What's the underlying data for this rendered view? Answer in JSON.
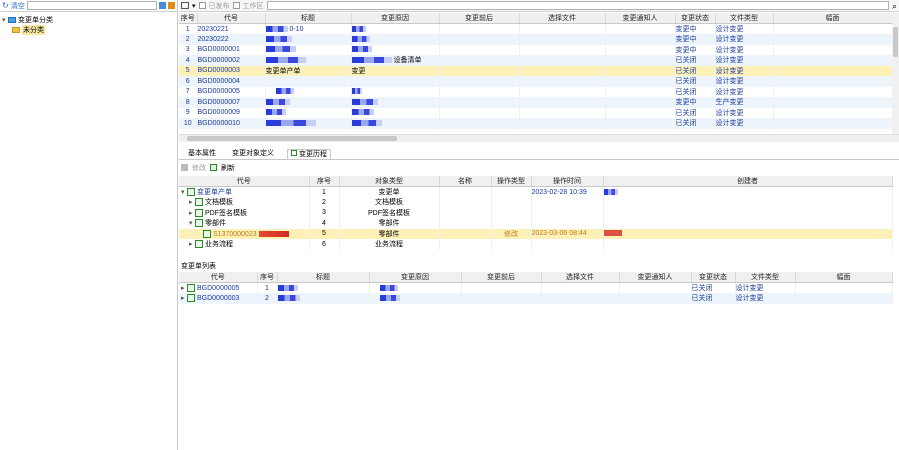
{
  "left": {
    "search_label": "清空",
    "tree": [
      {
        "label": "变更单分类",
        "level": 0
      },
      {
        "label": "未分类",
        "level": 1
      }
    ]
  },
  "toolbar": {
    "option1": "已发布",
    "option2": "工作区"
  },
  "main_table": {
    "columns": [
      "序号",
      "代号",
      "标题",
      "变更原因",
      "变更前后",
      "选择文件",
      "变更通知人",
      "变更状态",
      "文件类型",
      "幅面"
    ],
    "rows": [
      {
        "idx": "1",
        "code": "20230221",
        "title_tail": "0-10",
        "status": "变更中",
        "type": "设计变更"
      },
      {
        "idx": "2",
        "code": "20230222",
        "title_tail": "",
        "status": "变更中",
        "type": "设计变更"
      },
      {
        "idx": "3",
        "code": "BGD0000001",
        "title_tail": "",
        "status": "变更中",
        "type": "设计变更"
      },
      {
        "idx": "4",
        "code": "BGD0000002",
        "title_tail": "",
        "reason_tail": "设备清单",
        "status": "已关闭",
        "type": "设计变更"
      },
      {
        "idx": "5",
        "code": "BGD0000003",
        "title_text": "变更单产单",
        "reason_text": "变更",
        "status": "已关闭",
        "type": "设计变更"
      },
      {
        "idx": "6",
        "code": "BGD0000004",
        "title_tail": "",
        "status": "已关闭",
        "type": "设计变更"
      },
      {
        "idx": "7",
        "code": "BGD0000005",
        "title_tail": "",
        "status": "已关闭",
        "type": "设计变更"
      },
      {
        "idx": "8",
        "code": "BGD0000007",
        "title_tail": "",
        "status": "变更中",
        "type": "生产变更"
      },
      {
        "idx": "9",
        "code": "BGD0000009",
        "title_tail": "",
        "status": "已关闭",
        "type": "设计变更"
      },
      {
        "idx": "10",
        "code": "BGD0000010",
        "title_tail": "",
        "status": "已关闭",
        "type": "设计变更"
      }
    ]
  },
  "tabs": [
    "基本属性",
    "变更对象定义",
    "变更历程"
  ],
  "subtoolbar": {
    "edit": "修改",
    "refresh": "刷新"
  },
  "history": {
    "columns": [
      "代号",
      "序号",
      "对象类型",
      "名称",
      "操作类型",
      "操作时间",
      "创建者"
    ],
    "rows": [
      {
        "code": "变更单产单",
        "seq": "1",
        "type": "变更单",
        "op": "",
        "time": "2023-02-28 10:39"
      },
      {
        "code": "文档模板",
        "seq": "2",
        "type": "文档模板",
        "op": "",
        "time": ""
      },
      {
        "code": "PDF签名模板",
        "seq": "3",
        "type": "PDF签名模板",
        "op": "",
        "time": ""
      },
      {
        "code": "零部件",
        "seq": "4",
        "type": "零部件",
        "op": "",
        "time": ""
      },
      {
        "code": "S1370000023",
        "seq": "5",
        "type": "零部件",
        "op": "修改",
        "time": "2023-03-06 08:44"
      },
      {
        "code": "业务流程",
        "seq": "6",
        "type": "业务流程",
        "op": "",
        "time": ""
      }
    ]
  },
  "change_list": {
    "title": "变更单列表",
    "columns": [
      "代号",
      "序号",
      "标题",
      "变更原因",
      "变更前后",
      "选择文件",
      "变更通知人",
      "变更状态",
      "文件类型",
      "幅面"
    ],
    "rows": [
      {
        "code": "BGD0000005",
        "seq": "1",
        "status": "已关闭",
        "type": "设计变更"
      },
      {
        "code": "BGD0000003",
        "seq": "2",
        "status": "已关闭",
        "type": "设计变更"
      }
    ]
  }
}
